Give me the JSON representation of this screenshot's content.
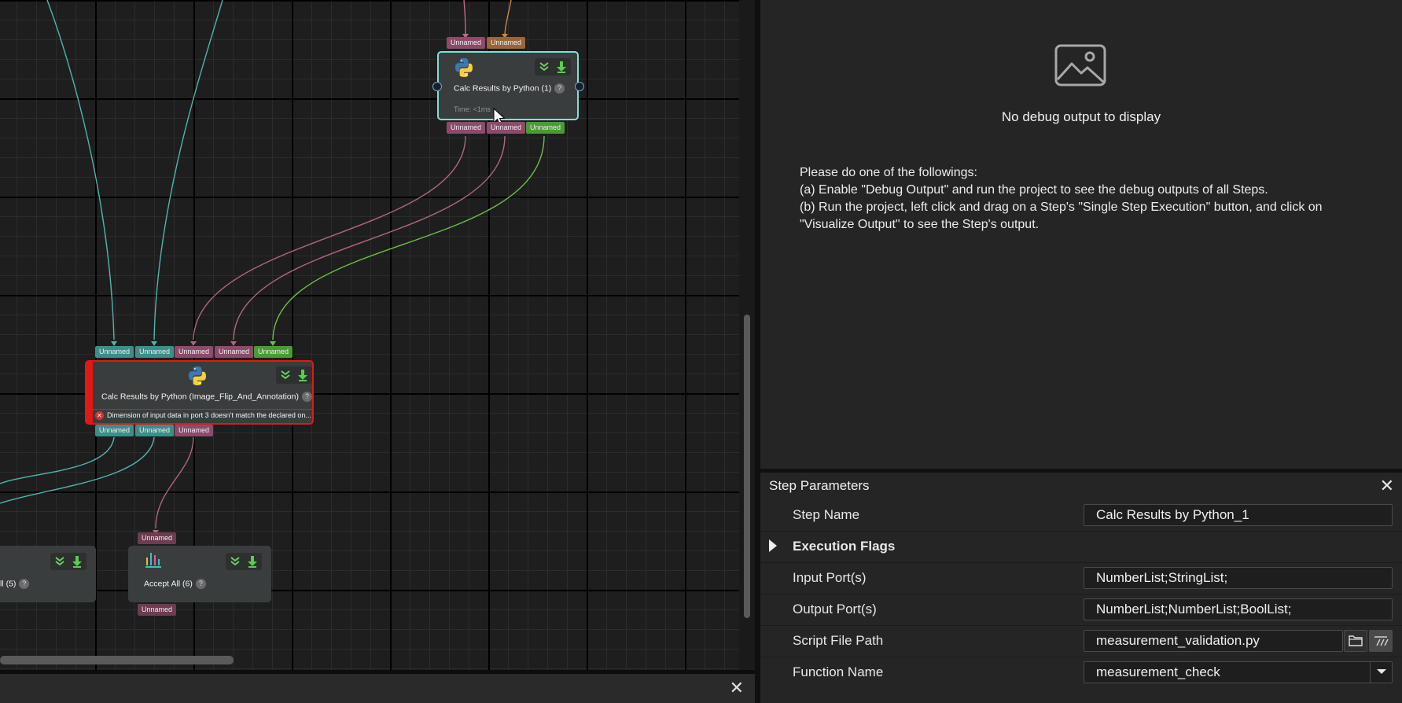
{
  "canvas": {
    "port_label": "Unnamed",
    "node_top": {
      "title": "Calc Results by Python (1)",
      "time": "Time: <1ms"
    },
    "node_main": {
      "title": "Calc Results by Python (Image_Flip_And_Annotation)",
      "error": "Dimension of input data in port 3 doesn't match the declared on..."
    },
    "node_accept5": {
      "title": "ll (5)"
    },
    "node_accept6": {
      "title": "Accept All (6)"
    }
  },
  "debug": {
    "no_output": "No debug output to display",
    "line1": "Please do one of the followings:",
    "line2": "(a) Enable \"Debug Output\" and run the project to see the debug outputs of all Steps.",
    "line3": "(b) Run the project, left click and drag on a Step's \"Single Step Execution\" button, and click on \"Visualize Output\" to see the Step's output."
  },
  "params": {
    "title": "Step Parameters",
    "rows": [
      {
        "label": "Step Name",
        "value": "Calc Results by Python_1"
      },
      {
        "label": "Execution Flags"
      },
      {
        "label": "Input Port(s)",
        "value": "NumberList;StringList;"
      },
      {
        "label": "Output Port(s)",
        "value": "NumberList;NumberList;BoolList;"
      },
      {
        "label": "Script File Path",
        "value": "measurement_validation.py"
      },
      {
        "label": "Function Name",
        "value": "measurement_check"
      }
    ]
  },
  "colors": {
    "port_teal": "#3a8f8a",
    "port_mauve": "#8c4b6a",
    "port_brown": "#9a6538",
    "port_green": "#4a9b35",
    "selected_border": "#7fe0d8",
    "error_border": "#e01818"
  }
}
